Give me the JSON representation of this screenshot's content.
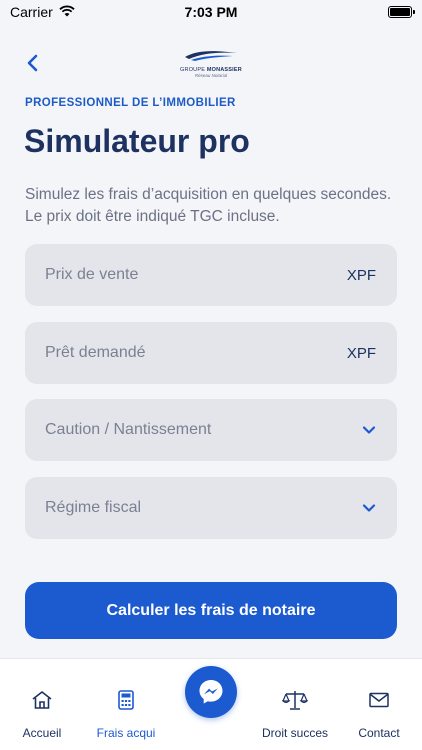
{
  "status_bar": {
    "carrier": "Carrier",
    "time": "7:03 PM"
  },
  "header": {
    "logo_brand_prefix": "GROUPE",
    "logo_brand_name": "MONASSIER",
    "logo_tagline": "Réseau Notarial"
  },
  "content": {
    "eyebrow": "PROFESSIONNEL DE L’IMMOBILIER",
    "title": "Simulateur pro",
    "description": "Simulez les frais d’acquisition en quelques secondes. Le prix doit être indiqué TGC incluse."
  },
  "form": {
    "fields": [
      {
        "label": "Prix de vente",
        "unit": "XPF"
      },
      {
        "label": "Prêt demandé",
        "unit": "XPF"
      },
      {
        "label": "Caution / Nantissement"
      },
      {
        "label": "Régime fiscal"
      }
    ],
    "submit_label": "Calculer les frais de notaire"
  },
  "tab_bar": {
    "items": [
      {
        "label": "Accueil",
        "icon": "home-icon"
      },
      {
        "label": "Frais acqui",
        "icon": "calculator-icon"
      },
      {
        "label": "",
        "icon": "messenger-icon"
      },
      {
        "label": "Droit succes",
        "icon": "scales-icon"
      },
      {
        "label": "Contact",
        "icon": "envelope-icon"
      }
    ],
    "active_index": 1
  },
  "colors": {
    "accent": "#1c5ad0",
    "title": "#1d3260",
    "background": "#f4f5f9",
    "field_background": "#e4e5ea"
  }
}
